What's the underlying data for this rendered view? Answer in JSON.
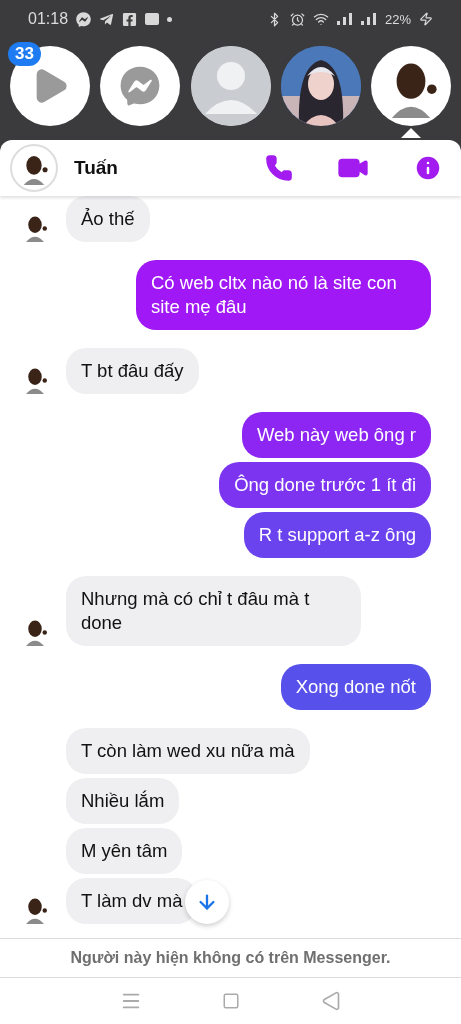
{
  "status_bar": {
    "time": "01:18",
    "battery": "22%"
  },
  "chat_heads": [
    {
      "kind": "play",
      "badge": "33",
      "selected": false
    },
    {
      "kind": "messenger",
      "selected": false
    },
    {
      "kind": "profile",
      "selected": false
    },
    {
      "kind": "picture",
      "selected": false
    },
    {
      "kind": "avatar",
      "selected": true
    }
  ],
  "header": {
    "name": "Tuấn"
  },
  "messages": [
    {
      "kind": "incoming",
      "text": "Ảo thế",
      "avatar": true
    },
    {
      "kind": "outgoing",
      "text": "Có web cltx nào nó là site con site mẹ đâu"
    },
    {
      "kind": "incoming",
      "text": "T bt đâu đấy",
      "avatar": true
    },
    {
      "kind": "outgoing",
      "text": "Web này web ông r"
    },
    {
      "kind": "outgoing",
      "text": "Ông done trước 1 ít đi"
    },
    {
      "kind": "outgoing",
      "text": "R t support a-z ông"
    },
    {
      "kind": "incoming",
      "text": "Nhưng mà có chỉ t đâu mà t done",
      "avatar": true
    },
    {
      "kind": "outgoing",
      "text": "Xong done nốt"
    },
    {
      "kind": "incoming",
      "text": "T còn làm wed xu nữa mà",
      "avatar": false
    },
    {
      "kind": "incoming",
      "text": "Nhiều lắm",
      "avatar": false
    },
    {
      "kind": "incoming",
      "text": "M yên tâm",
      "avatar": false
    },
    {
      "kind": "incoming",
      "text": "T làm dv mà",
      "avatar": true
    }
  ],
  "footer": {
    "notice": "Người này hiện không có trên Messenger."
  }
}
